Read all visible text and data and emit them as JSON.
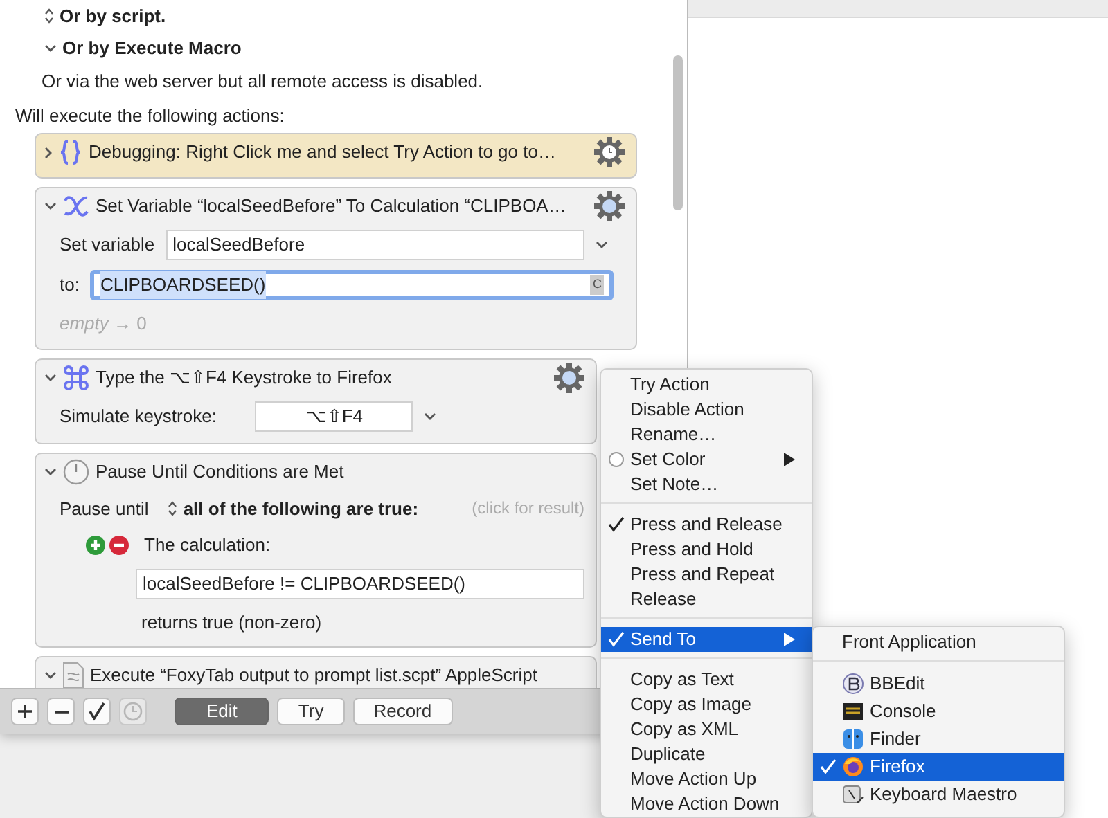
{
  "triggers": [
    {
      "kind": "popup",
      "label": "Or by script."
    },
    {
      "kind": "disclosure",
      "label": "Or by Execute Macro"
    }
  ],
  "web_note": "Or via the web server but all remote access is disabled.",
  "actions_heading": "Will execute the following actions:",
  "actions": [
    {
      "kind": "debug",
      "expanded": false,
      "color": "#f3e7c4",
      "title": "Debugging: Right Click me and select Try Action to go to…"
    },
    {
      "kind": "set_variable",
      "expanded": true,
      "color": "#f1f1f1",
      "title": "Set Variable “localSeedBefore” To Calculation “CLIPBOA…",
      "variable_label": "Set variable",
      "variable": "localSeedBefore",
      "to_label": "to:",
      "to_value": "CLIPBOARDSEED()",
      "token_badge": "C",
      "result": "*empty* → 0"
    },
    {
      "kind": "keystroke",
      "expanded": true,
      "color": "#f1f1f1",
      "title": "Type the ⌥⇧F4 Keystroke to Firefox",
      "keystroke_label": "Simulate keystroke:",
      "keystroke": "⌥⇧F4"
    },
    {
      "kind": "pause",
      "expanded": true,
      "color": "#f1f1f1",
      "title": "Pause Until Conditions are Met",
      "pause_label": "Pause until",
      "condition_mode": "all of the following are true:",
      "result_hint": "(click for result)",
      "condition_label": "The calculation:",
      "expression": "localSeedBefore != CLIPBOARDSEED()",
      "returns": "returns true (non-zero)"
    },
    {
      "kind": "applescript",
      "expanded": true,
      "color": "#f1f1f1",
      "title": "Execute “FoxyTab output to prompt list.scpt” AppleScript"
    }
  ],
  "toolbar": [
    {
      "kind": "add",
      "disabled": false
    },
    {
      "kind": "remove",
      "disabled": false
    },
    {
      "kind": "enable",
      "disabled": false
    },
    {
      "kind": "clock",
      "disabled": true
    },
    {
      "kind": "text",
      "label": "Edit",
      "selected": true
    },
    {
      "kind": "text",
      "label": "Try",
      "selected": false
    },
    {
      "kind": "text",
      "label": "Record",
      "selected": false
    }
  ],
  "menu": {
    "groups": [
      {
        "items": [
          {
            "label": "Try Action",
            "checked": false,
            "selected": false,
            "submenu": false
          },
          {
            "label": "Disable Action",
            "checked": false,
            "selected": false,
            "submenu": false
          },
          {
            "label": "Rename…",
            "checked": false,
            "selected": false,
            "submenu": false
          },
          {
            "label": "Set Color",
            "checked": false,
            "selected": false,
            "submenu": true,
            "kind": "radio"
          },
          {
            "label": "Set Note…",
            "checked": false,
            "selected": false,
            "submenu": false
          }
        ]
      },
      {
        "items": [
          {
            "label": "Press and Release",
            "checked": true,
            "selected": false,
            "submenu": false
          },
          {
            "label": "Press and Hold",
            "checked": false,
            "selected": false,
            "submenu": false
          },
          {
            "label": "Press and Repeat",
            "checked": false,
            "selected": false,
            "submenu": false
          },
          {
            "label": "Release",
            "checked": false,
            "selected": false,
            "submenu": false
          }
        ]
      },
      {
        "items": [
          {
            "label": "Send To",
            "checked": true,
            "selected": true,
            "submenu": true
          }
        ]
      },
      {
        "items": [
          {
            "label": "Copy as Text",
            "checked": false,
            "selected": false,
            "submenu": false
          },
          {
            "label": "Copy as Image",
            "checked": false,
            "selected": false,
            "submenu": false
          },
          {
            "label": "Copy as XML",
            "checked": false,
            "selected": false,
            "submenu": false
          },
          {
            "label": "Duplicate",
            "checked": false,
            "selected": false,
            "submenu": false
          },
          {
            "label": "Move Action Up",
            "checked": false,
            "selected": false,
            "submenu": false
          },
          {
            "label": "Move Action Down",
            "checked": false,
            "selected": false,
            "submenu": false
          }
        ]
      }
    ]
  },
  "submenu": {
    "first": {
      "label": "Front Application",
      "checked": false,
      "selected": false
    },
    "apps": [
      {
        "label": "BBEdit",
        "checked": false,
        "selected": false
      },
      {
        "label": "Console",
        "checked": false,
        "selected": false
      },
      {
        "label": "Finder",
        "checked": false,
        "selected": false
      },
      {
        "label": "Firefox",
        "checked": true,
        "selected": true
      },
      {
        "label": "Keyboard Maestro",
        "checked": false,
        "selected": false
      }
    ]
  }
}
